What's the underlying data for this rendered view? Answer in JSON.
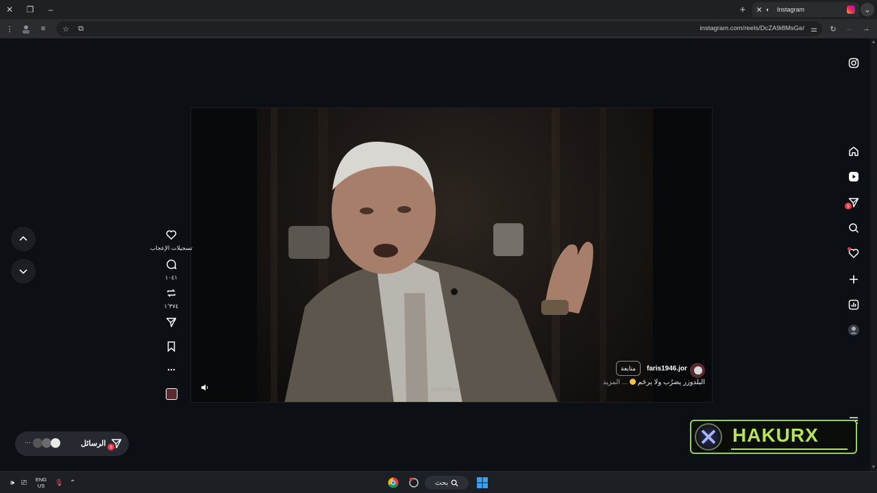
{
  "browser": {
    "tab_title": "Instagram",
    "url": "instagram.com/reels/DcZA9i8MsGe/"
  },
  "post": {
    "username": "faris1946.jor",
    "follow_label": "متابعة",
    "caption": "البلدوزر يضرُب ولا يرحَم",
    "more_label": "... المزيد",
    "watermark": "faris1946.jor"
  },
  "actions": {
    "likes_label": "تسجيلات الإعجاب",
    "comments_count": "١٠٤١",
    "reposts_count": "١٬٣٧٤"
  },
  "sidebar": {
    "messages_badge": "5"
  },
  "messages": {
    "label": "الرسائل",
    "badge": "5",
    "more": "..."
  },
  "overlay": {
    "logo_text": "HAKURX"
  },
  "taskbar": {
    "lang_line1": "ENG",
    "lang_line2": "US",
    "search_label": "بحث"
  },
  "colors": {
    "badge": "#ff3040",
    "hakurx_accent": "#9ad14b"
  }
}
